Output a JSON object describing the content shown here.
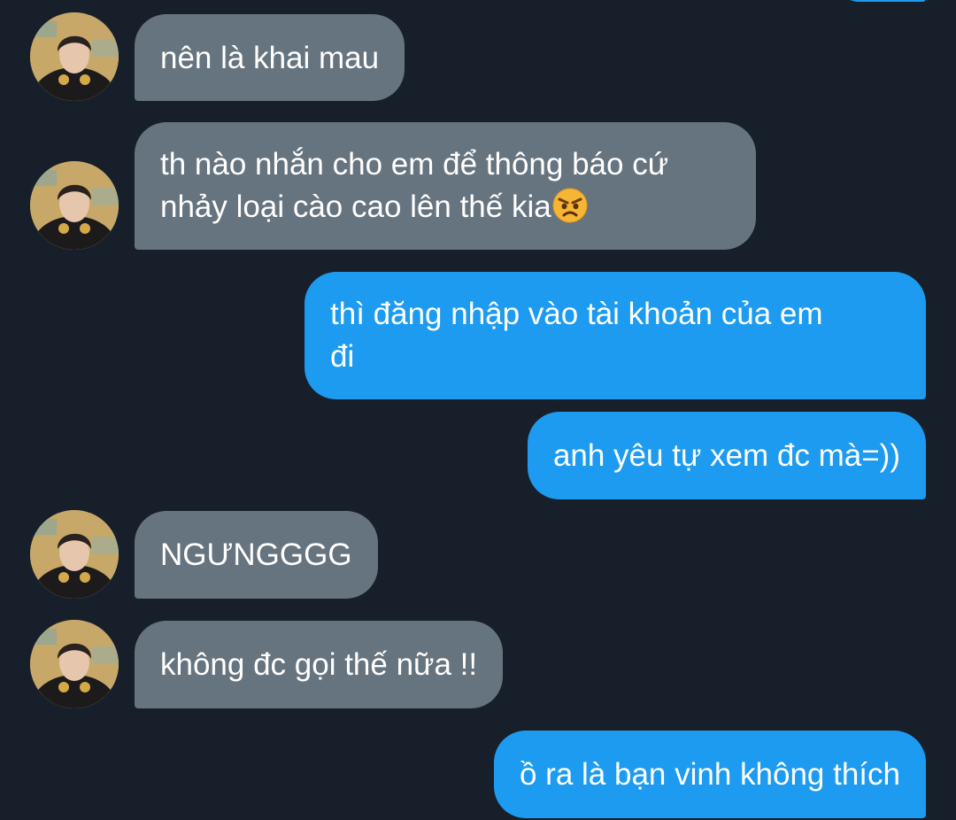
{
  "conversation": {
    "messages": [
      {
        "direction": "incoming",
        "text": "nên là khai mau"
      },
      {
        "direction": "incoming",
        "text": "th nào nhắn cho em để thông báo cứ",
        "text_line2": "nhảy loại cào cao lên thế kia",
        "emoji": "angry-face-icon"
      },
      {
        "direction": "outgoing",
        "text": "thì đăng nhập vào tài khoản của em",
        "text_line2": "đi"
      },
      {
        "direction": "outgoing",
        "text": "anh yêu tự xem đc mà=))"
      },
      {
        "direction": "incoming",
        "text": "NGƯNGGGG"
      },
      {
        "direction": "incoming",
        "text": "không đc gọi thế nữa !!"
      },
      {
        "direction": "outgoing",
        "text": "ồ ra là bạn vinh không thích"
      }
    ]
  },
  "colors": {
    "background": "#17202a",
    "incoming_bubble": "#66747f",
    "outgoing_bubble": "#1d9bf0",
    "text": "#ffffff"
  }
}
